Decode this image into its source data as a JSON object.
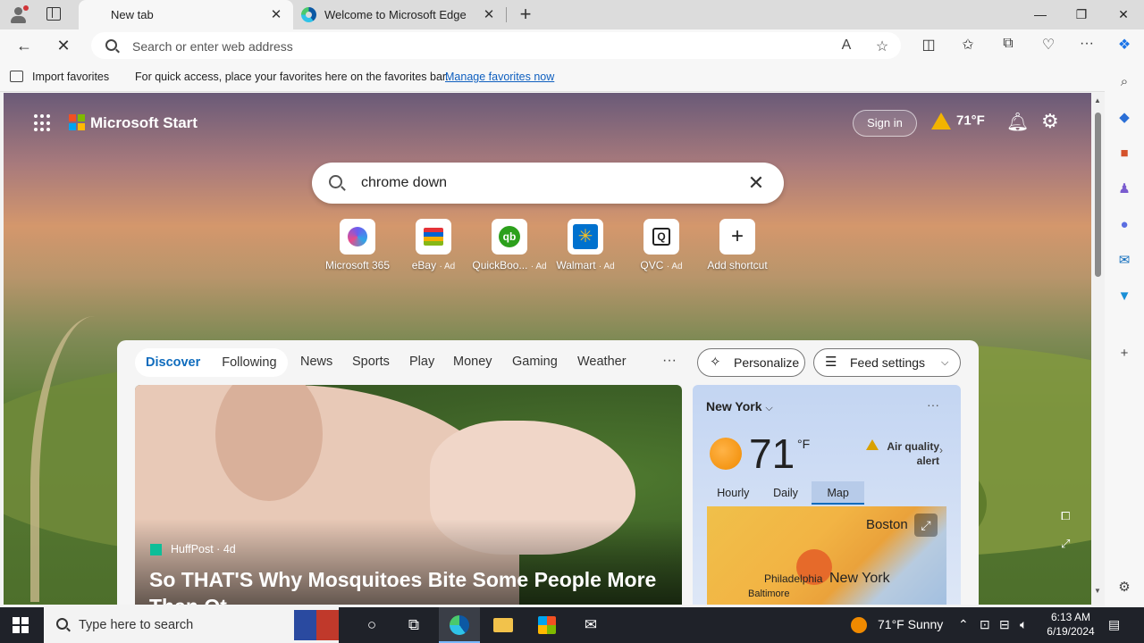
{
  "browser": {
    "tabs": [
      {
        "title": "New tab",
        "active": true
      },
      {
        "title": "Welcome to Microsoft Edge",
        "active": false
      }
    ],
    "address_placeholder": "Search or enter web address",
    "favorites_bar": {
      "import_label": "Import favorites",
      "hint": "For quick access, place your favorites here on the favorites bar.",
      "manage_link": "Manage favorites now"
    }
  },
  "start_page": {
    "brand": "Microsoft Start",
    "sign_in": "Sign in",
    "header_weather": "71°F",
    "search": {
      "value": "chrome down"
    },
    "shortcuts": [
      {
        "label": "Microsoft 365",
        "ad": "",
        "color": "#6b5cf0"
      },
      {
        "label": "eBay",
        "ad": "· Ad",
        "color": "#e53238"
      },
      {
        "label": "QuickBoo...",
        "ad": "· Ad",
        "color": "#2ca01c"
      },
      {
        "label": "Walmart",
        "ad": "· Ad",
        "color": "#0071ce"
      },
      {
        "label": "QVC",
        "ad": "· Ad",
        "color": "#222222"
      },
      {
        "label": "Add shortcut",
        "ad": "",
        "color": "#ffffff"
      }
    ],
    "feed_tabs": [
      "Discover",
      "Following"
    ],
    "feed_nav": [
      "News",
      "Sports",
      "Play",
      "Money",
      "Gaming",
      "Weather"
    ],
    "more_label": "···",
    "personalize": "Personalize",
    "feed_settings": "Feed settings",
    "hero": {
      "source": "HuffPost · 4d",
      "headline": "So THAT'S Why Mosquitoes Bite Some People More Than Ot..."
    },
    "weather_card": {
      "city": "New York",
      "temp": "71",
      "unit": "°F",
      "alert": "Air quality alert",
      "tabs": [
        "Hourly",
        "Daily",
        "Map"
      ],
      "active_tab": "Map",
      "map_labels": [
        "Boston",
        "Philadelphia",
        "New York",
        "Baltimore"
      ]
    }
  },
  "taskbar": {
    "search_placeholder": "Type here to search",
    "weather": "71°F  Sunny",
    "time": "6:13 AM",
    "date": "6/19/2024"
  }
}
